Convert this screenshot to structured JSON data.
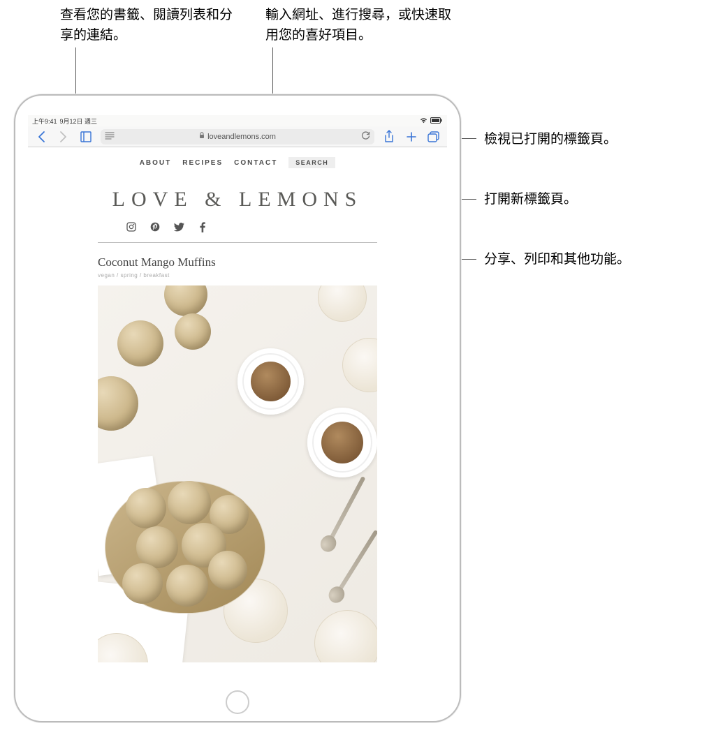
{
  "callouts": {
    "bookmarks": "查看您的書籤、閱讀列表和分享的連結。",
    "url_bar": "輸入網址、進行搜尋，或快速取用您的喜好項目。",
    "tabs": "檢視已打開的標籤頁。",
    "new_tab": "打開新標籤頁。",
    "share": "分享、列印和其他功能。"
  },
  "status_bar": {
    "time": "上午9:41",
    "date": "9月12日 週三"
  },
  "toolbar": {
    "url_text": "loveandlemons.com"
  },
  "webpage": {
    "nav": {
      "about": "ABOUT",
      "recipes": "RECIPES",
      "contact": "CONTACT",
      "search_label": "SEARCH"
    },
    "site_title": "LOVE & LEMONS",
    "post": {
      "title": "Coconut Mango Muffins",
      "meta": "vegan / spring / breakfast"
    }
  }
}
